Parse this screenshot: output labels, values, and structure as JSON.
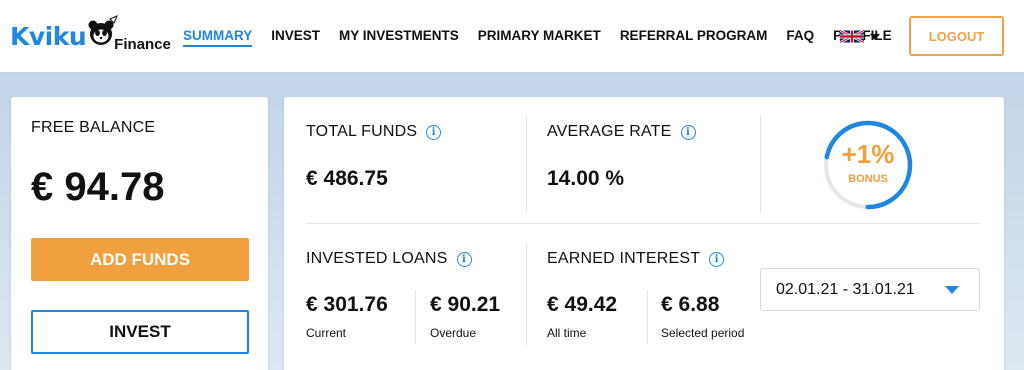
{
  "header": {
    "logo": {
      "brand": "Kviku",
      "sub": "Finance"
    },
    "nav": [
      {
        "label": "SUMMARY",
        "active": true
      },
      {
        "label": "INVEST",
        "active": false
      },
      {
        "label": "MY INVESTMENTS",
        "active": false
      },
      {
        "label": "PRIMARY MARKET",
        "active": false
      },
      {
        "label": "REFERRAL PROGRAM",
        "active": false
      },
      {
        "label": "FAQ",
        "active": false
      },
      {
        "label": "PROFILE",
        "active": false
      }
    ],
    "language_icon": "uk-flag-icon",
    "logout_label": "LOGOUT"
  },
  "free_balance": {
    "label": "FREE BALANCE",
    "value": "€ 94.78",
    "add_funds_label": "ADD FUNDS",
    "invest_label": "INVEST"
  },
  "stats": {
    "total_funds": {
      "label": "TOTAL FUNDS",
      "value": "€ 486.75"
    },
    "average_rate": {
      "label": "AVERAGE RATE",
      "value": "14.00 %"
    },
    "bonus": {
      "value": "+1%",
      "label": "BONUS",
      "progress": 0.72
    },
    "invested_loans": {
      "label": "INVESTED LOANS",
      "current": {
        "value": "€ 301.76",
        "label": "Current"
      },
      "overdue": {
        "value": "€ 90.21",
        "label": "Overdue"
      }
    },
    "earned_interest": {
      "label": "EARNED INTEREST",
      "all_time": {
        "value": "€ 49.42",
        "label": "All time"
      },
      "selected_period": {
        "value": "€ 6.88",
        "label": "Selected period"
      }
    },
    "period_select": {
      "value": "02.01.21 - 31.01.21"
    }
  },
  "colors": {
    "accent_blue": "#1f87e0",
    "accent_orange": "#f0a03f"
  }
}
